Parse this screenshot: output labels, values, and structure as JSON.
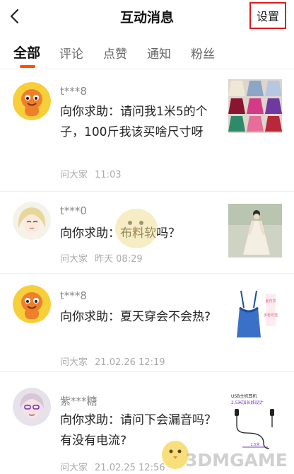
{
  "header": {
    "title": "互动消息",
    "settings_label": "设置"
  },
  "tabs": [
    {
      "label": "全部",
      "active": true
    },
    {
      "label": "评论",
      "active": false
    },
    {
      "label": "点赞",
      "active": false
    },
    {
      "label": "通知",
      "active": false
    },
    {
      "label": "粉丝",
      "active": false
    }
  ],
  "colors": {
    "accent": "#ff5000",
    "highlight_box": "#e0191a"
  },
  "messages": [
    {
      "user": "t***8",
      "text": "向你求助：请问我1米5的个子，100斤我该买啥尺寸呀",
      "source": "问大家",
      "time": "11:03",
      "avatar": "cartoon-mascot-avatar",
      "thumb": "colored-skirts-thumbnail"
    },
    {
      "user": "t***0",
      "text": "向你求助：布料软吗？",
      "source": "问大家",
      "time": "昨天 08:29",
      "avatar": "anime-girl-avatar",
      "thumb": "dress-model-thumbnail"
    },
    {
      "user": "t***8",
      "text": "向你求助：夏天穿会不会热?",
      "source": "问大家",
      "time": "21.02.26 12:19",
      "avatar": "cartoon-mascot-avatar",
      "thumb": "camisole-thumbnail"
    },
    {
      "user": "紫***糖",
      "text": "向你求助：请问下会漏音吗？有没有电流?",
      "source": "问大家",
      "time": "21.02.25 12:56",
      "avatar": "portrait-avatar",
      "thumb": "earphones-thumbnail"
    }
  ],
  "thumb_texts": {
    "camisole_tag": [
      "夏内衣",
      "多色可选"
    ],
    "earphone_line1": "USB主机耳机",
    "earphone_line2": "2.5米加长线设计",
    "earphone_length": "2.5米"
  },
  "watermark": {
    "text": "3DMGAME"
  }
}
